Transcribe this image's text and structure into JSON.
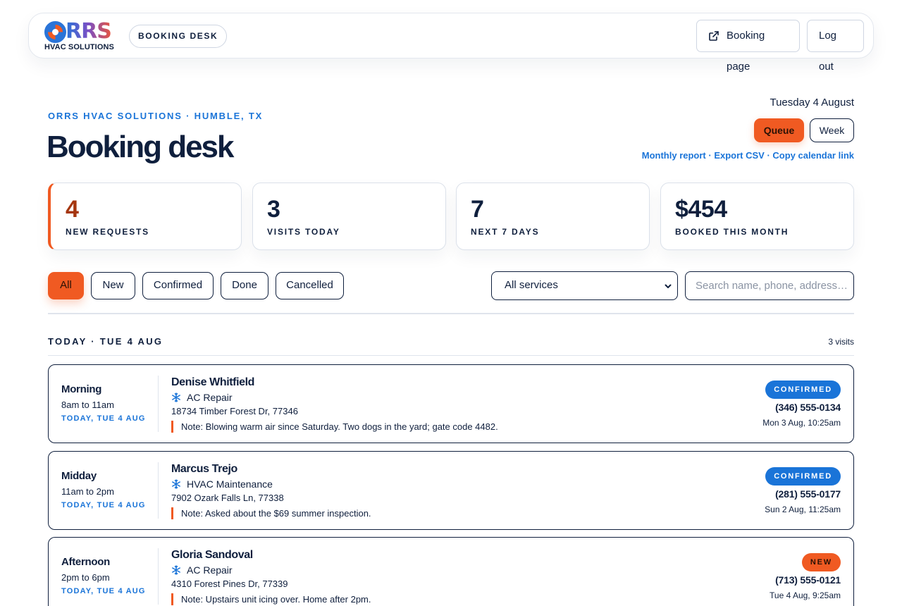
{
  "brand": {
    "wordmark": "RRS",
    "sub": "HVAC SOLUTIONS",
    "pill": "BOOKING DESK"
  },
  "topbar": {
    "booking_page_label": "Booking page",
    "logout_label": "Log out"
  },
  "header": {
    "eyebrow": "ORRS HVAC SOLUTIONS · HUMBLE, TX",
    "title": "Booking desk",
    "date": "Tuesday 4 August",
    "view_queue": "Queue",
    "view_week": "Week",
    "links": [
      "Monthly report",
      "Export CSV",
      "Copy calendar link"
    ],
    "link_separator": " · "
  },
  "stats": [
    {
      "value": "4",
      "label": "NEW REQUESTS"
    },
    {
      "value": "3",
      "label": "VISITS TODAY"
    },
    {
      "value": "7",
      "label": "NEXT 7 DAYS"
    },
    {
      "value": "$454",
      "label": "BOOKED THIS MONTH"
    }
  ],
  "filters": {
    "chips": [
      "All",
      "New",
      "Confirmed",
      "Done",
      "Cancelled"
    ],
    "active": "All",
    "service_select": "All services",
    "search_placeholder": "Search name, phone, address…"
  },
  "section": {
    "title": "TODAY · TUE 4 AUG",
    "count": "3 visits"
  },
  "bookings": [
    {
      "slot": "Morning",
      "time": "8am to 11am",
      "day": "TODAY, TUE 4 AUG",
      "name": "Denise Whitfield",
      "service": "AC Repair",
      "address": "18734 Timber Forest Dr, 77346",
      "note": "Note: Blowing warm air since Saturday. Two dogs in the yard; gate code 4482.",
      "status": "CONFIRMED",
      "phone": "(346) 555-0134",
      "created": "Mon 3 Aug, 10:25am"
    },
    {
      "slot": "Midday",
      "time": "11am to 2pm",
      "day": "TODAY, TUE 4 AUG",
      "name": "Marcus Trejo",
      "service": "HVAC Maintenance",
      "address": "7902 Ozark Falls Ln, 77338",
      "note": "Note: Asked about the $69 summer inspection.",
      "status": "CONFIRMED",
      "phone": "(281) 555-0177",
      "created": "Sun 2 Aug, 11:25am"
    },
    {
      "slot": "Afternoon",
      "time": "2pm to 6pm",
      "day": "TODAY, TUE 4 AUG",
      "name": "Gloria Sandoval",
      "service": "AC Repair",
      "address": "4310 Forest Pines Dr, 77339",
      "note": "Note: Upstairs unit icing over. Home after 2pm.",
      "status": "NEW",
      "phone": "(713) 555-0121",
      "created": "Tue 4 Aug, 9:25am"
    }
  ],
  "colors": {
    "accent": "#f05a22",
    "link": "#1a74d8",
    "ink": "#0f1f3d",
    "confirmed": "#1a74d8",
    "new": "#f05a22"
  },
  "icons": {
    "brand": "orrs-logo-icon",
    "booking_page": "external-link-icon",
    "service": "snowflake-icon",
    "select": "chevron-down-icon"
  }
}
